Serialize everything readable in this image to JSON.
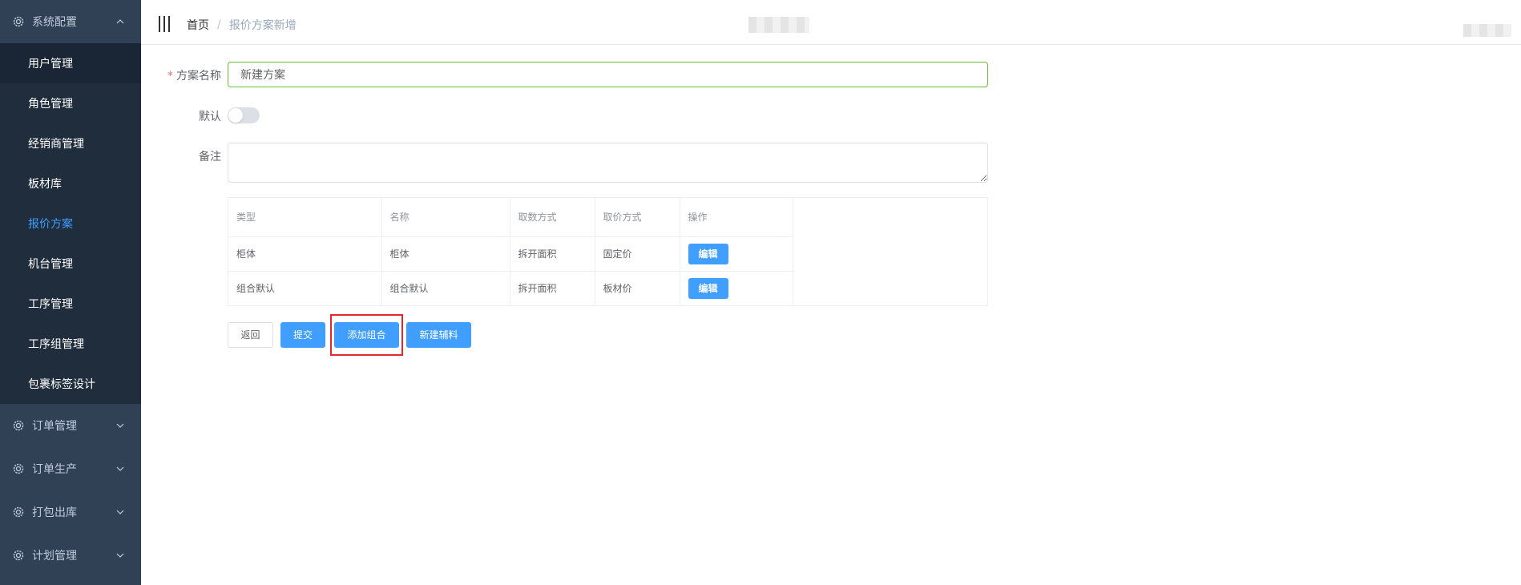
{
  "sidebar": {
    "groups": [
      {
        "label": "系统配置",
        "expanded": true,
        "items": [
          {
            "label": "用户管理"
          },
          {
            "label": "角色管理"
          },
          {
            "label": "经销商管理"
          },
          {
            "label": "板材库"
          },
          {
            "label": "报价方案",
            "active": true
          },
          {
            "label": "机台管理"
          },
          {
            "label": "工序管理"
          },
          {
            "label": "工序组管理"
          },
          {
            "label": "包裹标签设计"
          }
        ]
      },
      {
        "label": "订单管理",
        "expanded": false
      },
      {
        "label": "订单生产",
        "expanded": false
      },
      {
        "label": "打包出库",
        "expanded": false
      },
      {
        "label": "计划管理",
        "expanded": false
      }
    ]
  },
  "header": {
    "breadcrumb": {
      "home": "首页",
      "separator": "/",
      "current": "报价方案新增"
    }
  },
  "form": {
    "name_label": "方案名称",
    "required_mark": "*",
    "name_value": "新建方案",
    "default_label": "默认",
    "default_on": false,
    "remark_label": "备注",
    "remark_value": ""
  },
  "table": {
    "columns": [
      "类型",
      "名称",
      "取数方式",
      "取价方式",
      "操作"
    ],
    "rows": [
      {
        "type": "柜体",
        "name": "柜体",
        "count_method": "拆开面积",
        "price_method": "固定价",
        "action": "编辑"
      },
      {
        "type": "组合默认",
        "name": "组合默认",
        "count_method": "拆开面积",
        "price_method": "板材价",
        "action": "编辑"
      }
    ]
  },
  "actions": {
    "back": "返回",
    "submit": "提交",
    "add_combo": "添加组合",
    "new_accessory": "新建辅料"
  },
  "colors": {
    "sidebar_bg": "#304156",
    "submenu_bg": "#1f2d3d",
    "accent": "#409eff",
    "valid_border": "#67c23a",
    "highlight_box": "#e8262d"
  }
}
